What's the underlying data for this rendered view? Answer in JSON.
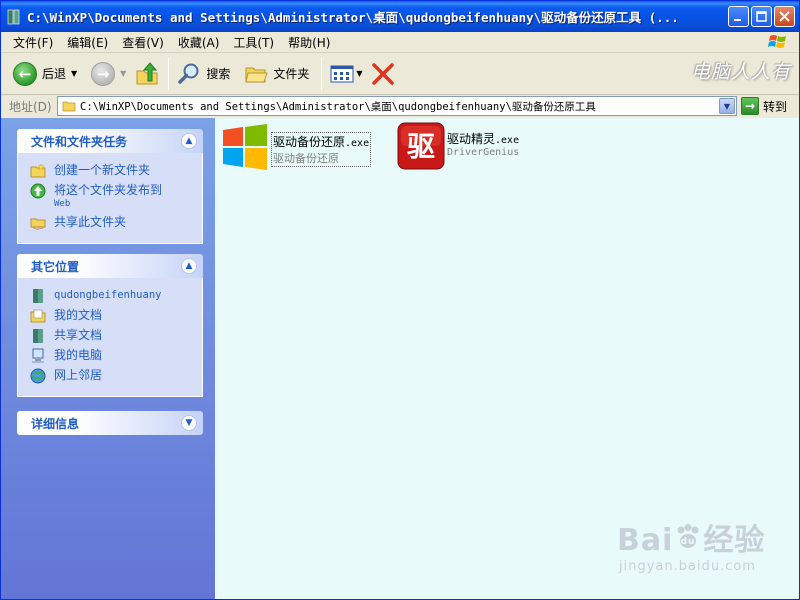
{
  "window": {
    "title": "C:\\WinXP\\Documents and Settings\\Administrator\\桌面\\qudongbeifenhuany\\驱动备份还原工具 (..."
  },
  "menu": {
    "items": [
      "文件(F)",
      "编辑(E)",
      "查看(V)",
      "收藏(A)",
      "工具(T)",
      "帮助(H)"
    ]
  },
  "toolbar": {
    "back_label": "后退",
    "search_label": "搜索",
    "folders_label": "文件夹",
    "watermark": "电脑人人有"
  },
  "address": {
    "label": "地址(D)",
    "path": "C:\\WinXP\\Documents and Settings\\Administrator\\桌面\\qudongbeifenhuany\\驱动备份还原工具",
    "go_label": "转到"
  },
  "sidebar": {
    "tasks": {
      "title": "文件和文件夹任务",
      "items": [
        {
          "label": "创建一个新文件夹",
          "sub": ""
        },
        {
          "label": "将这个文件夹发布到",
          "sub": "Web"
        },
        {
          "label": "共享此文件夹",
          "sub": ""
        }
      ]
    },
    "places": {
      "title": "其它位置",
      "items": [
        "qudongbeifenhuany",
        "我的文档",
        "共享文档",
        "我的电脑",
        "网上邻居"
      ]
    },
    "details": {
      "title": "详细信息"
    }
  },
  "files": [
    {
      "name": "驱动备份还原",
      "ext": ".exe",
      "desc": "驱动备份还原",
      "icon": "windows-logo-icon"
    },
    {
      "name": "驱动精灵",
      "ext": ".exe",
      "desc": "DriverGenius",
      "icon": "driver-genius-icon",
      "icon_text": "驱"
    }
  ],
  "watermark": {
    "brand": "Bai",
    "brand_tail": "经验",
    "url": "jingyan.baidu.com"
  },
  "colors": {
    "title_bar": "#0a5cf0",
    "sidebar_link": "#215dc6",
    "content_bg": "#e8fafa"
  }
}
